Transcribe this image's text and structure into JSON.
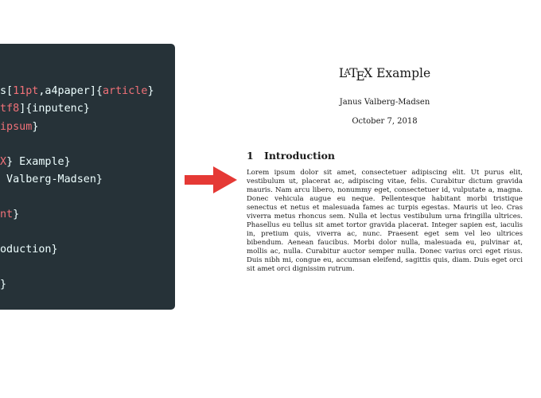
{
  "code": {
    "lines": [
      [
        {
          "t": "s[",
          "c": "plain"
        },
        {
          "t": "11pt",
          "c": "red"
        },
        {
          "t": ",a4paper]{",
          "c": "plain"
        },
        {
          "t": "article",
          "c": "red"
        },
        {
          "t": "}",
          "c": "plain"
        }
      ],
      [
        {
          "t": "tf8",
          "c": "red"
        },
        {
          "t": "]{inputenc}",
          "c": "plain"
        }
      ],
      [
        {
          "t": "ipsum",
          "c": "red"
        },
        {
          "t": "}",
          "c": "plain"
        }
      ],
      [],
      [
        {
          "t": "X",
          "c": "red"
        },
        {
          "t": "} Example}",
          "c": "plain"
        }
      ],
      [
        {
          "t": " Valberg-Madsen}",
          "c": "plain"
        }
      ],
      [],
      [
        {
          "t": "nt",
          "c": "red"
        },
        {
          "t": "}",
          "c": "plain"
        }
      ],
      [],
      [
        {
          "t": "oduction}",
          "c": "plain"
        }
      ],
      [],
      [
        {
          "t": "}",
          "c": "plain"
        }
      ]
    ]
  },
  "document": {
    "title_logo": {
      "l": "L",
      "a": "A",
      "t": "T",
      "e": "E",
      "x": "X"
    },
    "title_rest": " Example",
    "author": "Janus Valberg-Madsen",
    "date": "October 7, 2018",
    "section": {
      "number": "1",
      "title": "Introduction"
    },
    "body": "Lorem ipsum dolor sit amet, consectetuer adipiscing elit. Ut purus elit, vestibulum ut, placerat ac, adipiscing vitae, felis. Curabitur dictum gravida mauris. Nam arcu libero, nonummy eget, consectetuer id, vulputate a, magna. Donec vehicula augue eu neque. Pellentesque habitant morbi tristique senectus et netus et malesuada fames ac turpis egestas. Mauris ut leo. Cras viverra metus rhoncus sem. Nulla et lectus vestibulum urna fringilla ultrices. Phasellus eu tellus sit amet tortor gravida placerat. Integer sapien est, iaculis in, pretium quis, viverra ac, nunc. Praesent eget sem vel leo ultrices bibendum. Aenean faucibus. Morbi dolor nulla, malesuada eu, pulvinar at, mollis ac, nulla. Curabitur auctor semper nulla. Donec varius orci eget risus. Duis nibh mi, congue eu, accumsan eleifend, sagittis quis, diam. Duis eget orci sit amet orci dignissim rutrum."
  },
  "colors": {
    "editor_background": "#263238",
    "code_text": "#eeffff",
    "code_highlight": "#f07178",
    "arrow": "#e53935"
  }
}
